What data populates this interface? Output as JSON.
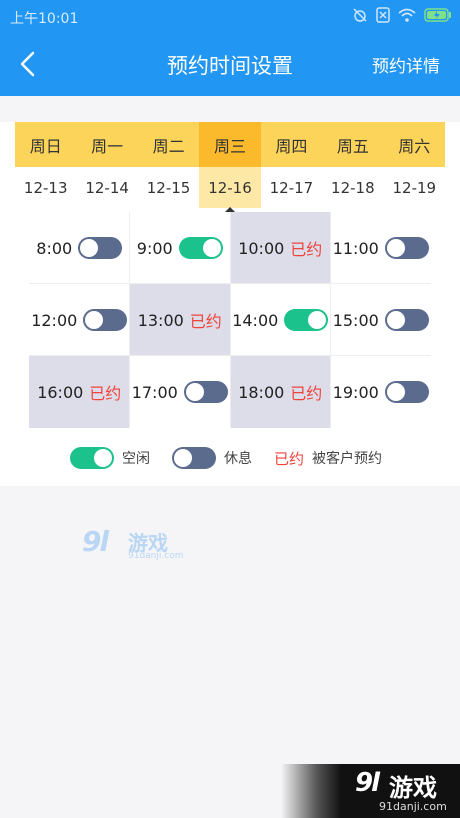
{
  "status_bar": {
    "time": "上午10:01"
  },
  "header": {
    "title": "预约时间设置",
    "detail_label": "预约详情"
  },
  "colors": {
    "primary": "#2196f3",
    "tab_bg": "#fdd45a",
    "tab_active": "#fbb92c",
    "tab_active_date": "#fde9a5",
    "booked_bg": "#dcdde9",
    "toggle_on": "#1bc28b",
    "toggle_off": "#5a6b8e",
    "booked_text": "#f1433b"
  },
  "week": [
    {
      "day": "周日",
      "date": "12-13"
    },
    {
      "day": "周一",
      "date": "12-14"
    },
    {
      "day": "周二",
      "date": "12-15"
    },
    {
      "day": "周三",
      "date": "12-16",
      "active": true
    },
    {
      "day": "周四",
      "date": "12-17"
    },
    {
      "day": "周五",
      "date": "12-18"
    },
    {
      "day": "周六",
      "date": "12-19"
    }
  ],
  "slots": [
    {
      "time": "8:00",
      "state": "off"
    },
    {
      "time": "9:00",
      "state": "on"
    },
    {
      "time": "10:00",
      "state": "booked"
    },
    {
      "time": "11:00",
      "state": "off"
    },
    {
      "time": "12:00",
      "state": "off"
    },
    {
      "time": "13:00",
      "state": "booked"
    },
    {
      "time": "14:00",
      "state": "on"
    },
    {
      "time": "15:00",
      "state": "off"
    },
    {
      "time": "16:00",
      "state": "booked"
    },
    {
      "time": "17:00",
      "state": "off"
    },
    {
      "time": "18:00",
      "state": "booked"
    },
    {
      "time": "19:00",
      "state": "off"
    }
  ],
  "booked_label": "已约",
  "legend": {
    "free": "空闲",
    "rest": "休息",
    "booked_word": "已约",
    "booked_desc": "被客户预约"
  },
  "watermark": {
    "logo": "9l",
    "name": "游戏",
    "site": "91danji.com"
  }
}
